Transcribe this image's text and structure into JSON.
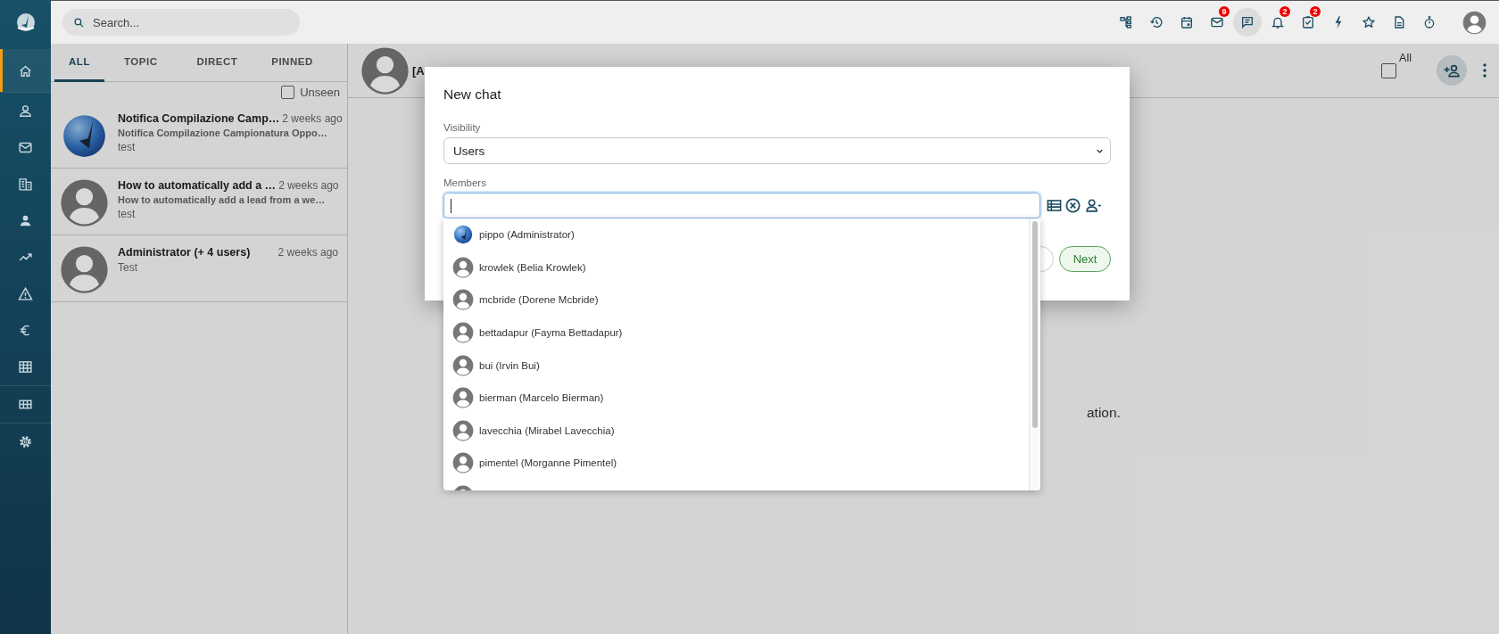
{
  "nav": {
    "items": [
      {
        "selected": true
      },
      {
        "selected": false
      },
      {
        "selected": false
      },
      {
        "selected": false
      },
      {
        "selected": false
      },
      {
        "selected": false
      },
      {
        "selected": false
      },
      {
        "selected": false
      },
      {
        "selected": false
      },
      {
        "selected": false
      },
      {
        "selected": false
      }
    ]
  },
  "search": {
    "placeholder": "Search..."
  },
  "toolbar": {
    "items": [
      {
        "selected": false
      },
      {
        "selected": false
      },
      {
        "selected": false
      },
      {
        "selected": false,
        "badge": "9"
      },
      {
        "selected": true
      },
      {
        "selected": false,
        "badge": "2"
      },
      {
        "selected": false,
        "badge": "2"
      },
      {
        "selected": false
      },
      {
        "selected": false
      },
      {
        "selected": false
      },
      {
        "selected": false
      }
    ]
  },
  "chat_list": {
    "tabs": [
      {
        "label": "ALL",
        "selected": true
      },
      {
        "label": "TOPIC",
        "selected": false
      },
      {
        "label": "DIRECT",
        "selected": false
      },
      {
        "label": "PINNED",
        "selected": false
      }
    ],
    "unseen": {
      "label": "Unseen",
      "checked": false
    },
    "chats": [
      {
        "kind": "logo",
        "title": "Notifica Compilazione Camp…",
        "time": "2 weeks ago",
        "preview": "Notifica Compilazione Campionatura Oppo…",
        "subtitle": "test"
      },
      {
        "kind": "person",
        "title": "How to automatically add a …",
        "time": "2 weeks ago",
        "preview": "How to automatically add a lead from a we…",
        "subtitle": "test"
      },
      {
        "kind": "person",
        "title": "Administrator (+ 4 users)",
        "time": "2 weeks ago",
        "subtitle": "Test"
      }
    ]
  },
  "conversation": {
    "title": "[A",
    "select_all": {
      "label": "All",
      "checked": false
    },
    "body_text": "ation."
  },
  "dialog": {
    "title": "New chat",
    "visibility": {
      "label": "Visibility",
      "value": "Users"
    },
    "members": {
      "label": "Members",
      "options": [
        {
          "kind": "logo",
          "label": "pippo (Administrator)"
        },
        {
          "kind": "person",
          "label": "krowlek (Belia Krowlek)"
        },
        {
          "kind": "person",
          "label": "mcbride (Dorene Mcbride)"
        },
        {
          "kind": "person",
          "label": "bettadapur (Fayma Bettadapur)"
        },
        {
          "kind": "person",
          "label": "bui (Irvin Bui)"
        },
        {
          "kind": "person",
          "label": "bierman (Marcelo Bierman)"
        },
        {
          "kind": "person",
          "label": "lavecchia (Mirabel Lavecchia)"
        },
        {
          "kind": "person",
          "label": "pimentel (Morganne Pimentel)"
        },
        {
          "kind": "person"
        }
      ]
    },
    "buttons": [
      {
        "kind": "outline"
      },
      {
        "kind": "primary",
        "label": "Next"
      }
    ]
  }
}
